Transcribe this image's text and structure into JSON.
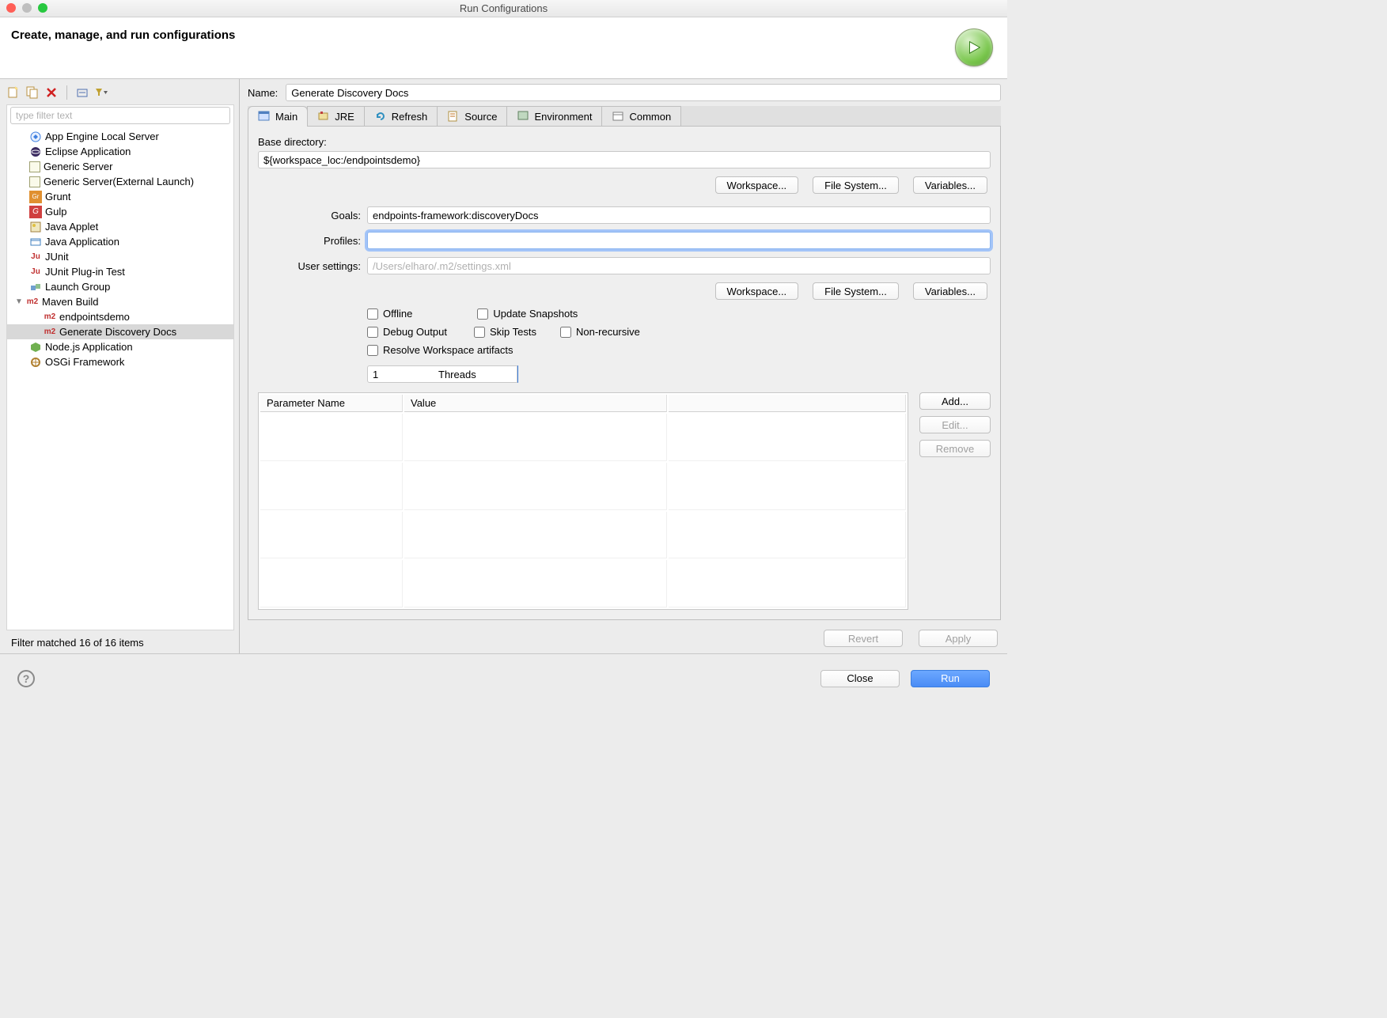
{
  "window_title": "Run Configurations",
  "header": {
    "title": "Create, manage, and run configurations"
  },
  "left": {
    "filter_placeholder": "type filter text",
    "tree": [
      {
        "label": "App Engine Local Server"
      },
      {
        "label": "Eclipse Application"
      },
      {
        "label": "Generic Server"
      },
      {
        "label": "Generic Server(External Launch)"
      },
      {
        "label": "Grunt"
      },
      {
        "label": "Gulp"
      },
      {
        "label": "Java Applet"
      },
      {
        "label": "Java Application"
      },
      {
        "label": "JUnit"
      },
      {
        "label": "JUnit Plug-in Test"
      },
      {
        "label": "Launch Group"
      },
      {
        "label": "Maven Build",
        "expanded": true,
        "kind": "m2",
        "children": [
          {
            "label": "endpointsdemo",
            "kind": "m2"
          },
          {
            "label": "Generate Discovery Docs",
            "kind": "m2",
            "selected": true
          }
        ]
      },
      {
        "label": "Node.js Application"
      },
      {
        "label": "OSGi Framework"
      }
    ],
    "filter_status": "Filter matched 16 of 16 items"
  },
  "right": {
    "name_label": "Name:",
    "name_value": "Generate Discovery Docs",
    "tabs": [
      {
        "label": "Main",
        "active": true
      },
      {
        "label": "JRE"
      },
      {
        "label": "Refresh"
      },
      {
        "label": "Source"
      },
      {
        "label": "Environment"
      },
      {
        "label": "Common"
      }
    ],
    "base_dir_label": "Base directory:",
    "base_dir_value": "${workspace_loc:/endpointsdemo}",
    "btn_workspace": "Workspace...",
    "btn_filesystem": "File System...",
    "btn_variables": "Variables...",
    "goals_label": "Goals:",
    "goals_value": "endpoints-framework:discoveryDocs",
    "profiles_label": "Profiles:",
    "profiles_value": "",
    "usersettings_label": "User settings:",
    "usersettings_placeholder": "/Users/elharo/.m2/settings.xml",
    "checks": {
      "offline": "Offline",
      "update": "Update Snapshots",
      "debug": "Debug Output",
      "skip": "Skip Tests",
      "nonrec": "Non-recursive",
      "resolve": "Resolve Workspace artifacts"
    },
    "threads_value": "1",
    "threads_label": "Threads",
    "params": {
      "col_name": "Parameter Name",
      "col_value": "Value",
      "btn_add": "Add...",
      "btn_edit": "Edit...",
      "btn_remove": "Remove"
    },
    "revert": "Revert",
    "apply": "Apply"
  },
  "footer": {
    "close": "Close",
    "run": "Run"
  }
}
